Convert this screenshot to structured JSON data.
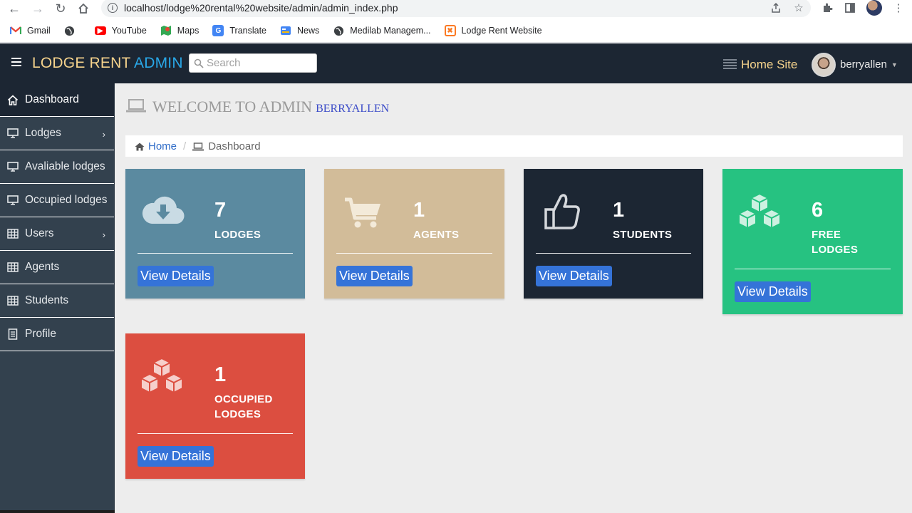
{
  "browser": {
    "url": "localhost/lodge%20rental%20website/admin/admin_index.php",
    "bookmarks": [
      {
        "label": "Gmail",
        "icon": "gmail-icon"
      },
      {
        "label": "",
        "icon": "globe-icon"
      },
      {
        "label": "YouTube",
        "icon": "youtube-icon"
      },
      {
        "label": "Maps",
        "icon": "maps-icon"
      },
      {
        "label": "Translate",
        "icon": "translate-icon"
      },
      {
        "label": "News",
        "icon": "news-icon"
      },
      {
        "label": "Medilab Managem...",
        "icon": "globe-icon"
      },
      {
        "label": "Lodge Rent Website",
        "icon": "xampp-icon"
      }
    ]
  },
  "header": {
    "brand_part1": "LODGE RENT",
    "brand_part2": "ADMIN",
    "search_placeholder": "Search",
    "home_site": "Home Site",
    "username": "berryallen"
  },
  "sidebar": {
    "items": [
      {
        "label": "Dashboard",
        "icon": "home-icon",
        "active": true
      },
      {
        "label": "Lodges",
        "icon": "monitor-icon",
        "chevron": true
      },
      {
        "label": "Avaliable lodges",
        "icon": "monitor-icon"
      },
      {
        "label": "Occupied lodges",
        "icon": "monitor-icon"
      },
      {
        "label": "Users",
        "icon": "table-icon",
        "chevron": true
      },
      {
        "label": "Agents",
        "icon": "table-icon"
      },
      {
        "label": "Students",
        "icon": "table-icon"
      },
      {
        "label": "Profile",
        "icon": "document-icon"
      }
    ]
  },
  "main": {
    "welcome": "WELCOME TO ADMIN",
    "welcome_user": "BERRYALLEN",
    "breadcrumb": {
      "home": "Home",
      "current": "Dashboard"
    },
    "cards": [
      {
        "count": "7",
        "label": "LODGES",
        "button": "View Details",
        "color": "#5b8aa0",
        "icon": "cloud-download-icon"
      },
      {
        "count": "1",
        "label": "AGENTS",
        "button": "View Details",
        "color": "#d2bc99",
        "icon": "shopping-cart-icon"
      },
      {
        "count": "1",
        "label": "STUDENTS",
        "button": "View Details",
        "color": "#1c2633",
        "icon": "thumbs-up-icon"
      },
      {
        "count": "6",
        "label_line1": "FREE",
        "label_line2": "LODGES",
        "button": "View Details",
        "color": "#26c281",
        "icon": "cubes-icon"
      },
      {
        "count": "1",
        "label_line1": "OCCUPIED",
        "label_line2": "LODGES",
        "button": "View Details",
        "color": "#dc4e40",
        "icon": "cubes-icon"
      }
    ]
  },
  "colors": {
    "navbar": "#1c2633",
    "sidebar": "#33414e",
    "brand_gold": "#f6d38c",
    "brand_blue": "#29a8e8",
    "button_blue": "#3573d8"
  }
}
